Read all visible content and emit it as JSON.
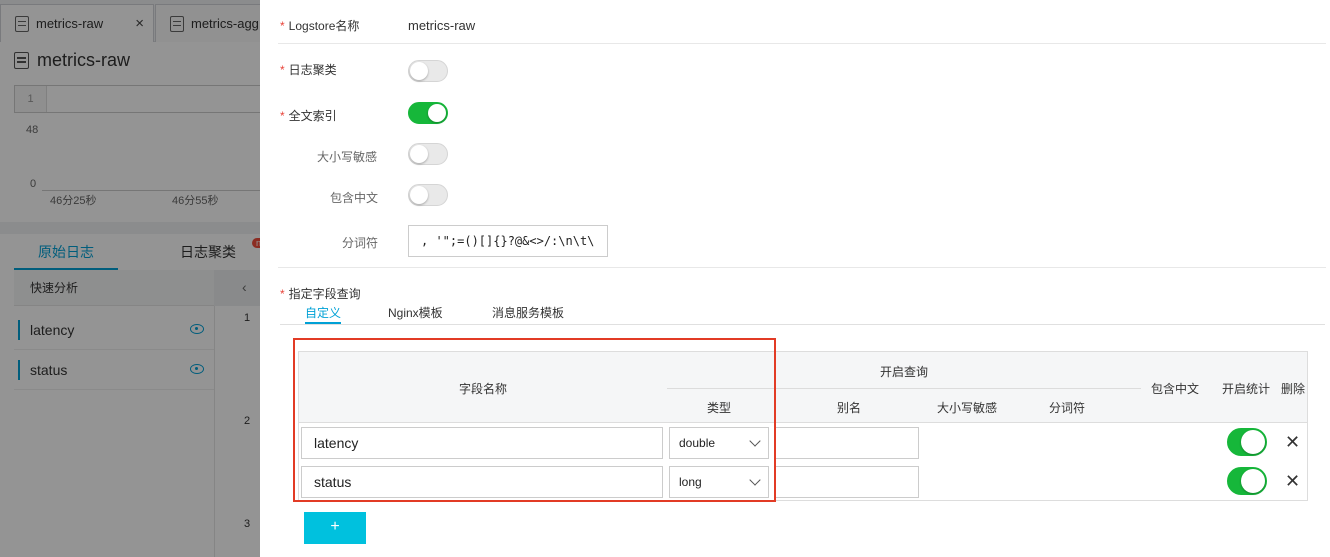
{
  "bg": {
    "tabs": [
      {
        "label": "metrics-raw",
        "close": "×"
      },
      {
        "label": "metrics-agg"
      }
    ],
    "title": "metrics-raw",
    "query_line": "1",
    "chart": {
      "y_top": "48",
      "y_bottom": "0",
      "x_ticks": [
        "46分25秒",
        "46分55秒"
      ]
    },
    "log_tabs": {
      "raw": "原始日志",
      "cluster": "日志聚类",
      "badge": "new"
    },
    "quick_analysis": "快速分析",
    "collapse": "‹",
    "fields": [
      "latency",
      "status"
    ],
    "row_numbers": [
      "1",
      "2",
      "3"
    ]
  },
  "panel": {
    "logstore_label": "Logstore名称",
    "logstore_value": "metrics-raw",
    "log_cluster_label": "日志聚类",
    "log_cluster_on": false,
    "fulltext_label": "全文索引",
    "fulltext_on": true,
    "case_sensitive_label": "大小写敏感",
    "case_sensitive_on": false,
    "chinese_label": "包含中文",
    "chinese_on": false,
    "delimiter_label": "分词符",
    "delimiter_value": ", '\";=()[]{}?@&<>/:\\n\\t\\r",
    "field_query_label": "指定字段查询",
    "subtabs": [
      "自定义",
      "Nginx模板",
      "消息服务模板"
    ],
    "table": {
      "col_field": "字段名称",
      "col_group": "开启查询",
      "col_type": "类型",
      "col_alias": "别名",
      "col_case": "大小写敏感",
      "col_delim": "分词符",
      "col_chinese": "包含中文",
      "col_stats": "开启统计",
      "col_delete": "删除",
      "rows": [
        {
          "field": "latency",
          "type": "double",
          "alias": "",
          "stats_on": true
        },
        {
          "field": "status",
          "type": "long",
          "alias": "",
          "stats_on": true
        }
      ],
      "delete_glyph": "✕"
    },
    "add_button": "+"
  }
}
